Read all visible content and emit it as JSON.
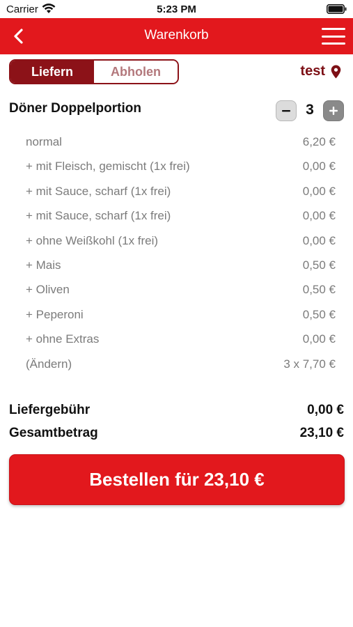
{
  "status_bar": {
    "carrier": "Carrier",
    "time": "5:23 PM"
  },
  "nav": {
    "title": "Warenkorb",
    "back_icon": "chevron-left-icon",
    "menu_icon": "hamburger-menu-icon"
  },
  "mode": {
    "options": [
      "Liefern",
      "Abholen"
    ],
    "selected": "Liefern"
  },
  "location": {
    "label": "test",
    "icon": "map-pin-icon"
  },
  "product": {
    "name": "Döner Doppelportion",
    "quantity": "3"
  },
  "items": [
    {
      "label": "normal",
      "price": "6,20 €"
    },
    {
      "label": "+ mit Fleisch, gemischt (1x frei)",
      "price": "0,00 €"
    },
    {
      "label": "+ mit Sauce, scharf (1x frei)",
      "price": "0,00 €"
    },
    {
      "label": "+ mit Sauce, scharf (1x frei)",
      "price": "0,00 €"
    },
    {
      "label": "+ ohne Weißkohl (1x frei)",
      "price": "0,00 €"
    },
    {
      "label": "+ Mais",
      "price": "0,50 €"
    },
    {
      "label": "+ Oliven",
      "price": "0,50 €"
    },
    {
      "label": "+ Peperoni",
      "price": "0,50 €"
    },
    {
      "label": "+ ohne Extras",
      "price": "0,00 €"
    },
    {
      "label": "(Ändern)",
      "price": "3 x 7,70 €"
    }
  ],
  "summary": {
    "delivery_fee_label": "Liefergebühr",
    "delivery_fee_value": "0,00 €",
    "total_label": "Gesamtbetrag",
    "total_value": "23,10 €"
  },
  "order_button": {
    "label": "Bestellen für 23,10 €"
  },
  "colors": {
    "brand_red": "#e2181d",
    "dark_red": "#8c1218",
    "muted_text": "#7b7b7b"
  }
}
